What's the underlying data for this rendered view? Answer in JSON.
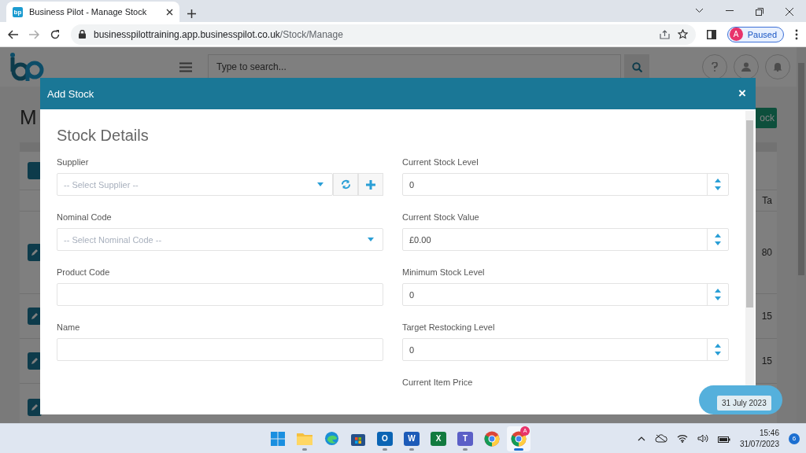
{
  "browser": {
    "tab": {
      "favicon": "bp",
      "title": "Business Pilot - Manage Stock",
      "selected": true
    },
    "url_host": "businesspilottraining.app.businesspilot.co.uk",
    "url_path": "/Stock/Manage",
    "profile": {
      "initial": "A",
      "status": "Paused"
    }
  },
  "app": {
    "search": {
      "placeholder": "Type to search..."
    },
    "page_title": "M",
    "action_button": "ock",
    "table": {
      "header": "Ta",
      "rows": [
        {
          "cell": "80"
        },
        {
          "cell": "15"
        },
        {
          "cell": "15"
        },
        {}
      ]
    }
  },
  "modal": {
    "title": "Add Stock",
    "close": "×",
    "section": "Stock Details",
    "left_fields": [
      {
        "label": "Supplier",
        "kind": "select",
        "placeholder": "-- Select Supplier --",
        "addons": true
      },
      {
        "label": "Nominal Code",
        "kind": "select",
        "placeholder": "-- Select Nominal Code --",
        "addons": false
      },
      {
        "label": "Product Code",
        "kind": "text"
      },
      {
        "label": "Name",
        "kind": "text"
      }
    ],
    "right_fields": [
      {
        "label": "Current Stock Level",
        "kind": "number",
        "value": "0"
      },
      {
        "label": "Current Stock Value",
        "kind": "number",
        "value": "£0.00"
      },
      {
        "label": "Minimum Stock Level",
        "kind": "number",
        "value": "0"
      },
      {
        "label": "Target Restocking Level",
        "kind": "number",
        "value": "0"
      },
      {
        "label": "Current Item Price",
        "kind": "cut"
      }
    ]
  },
  "date_tooltip": "31 July 2023",
  "taskbar": {
    "apps": [
      {
        "kind": "start",
        "running": false,
        "active": false
      },
      {
        "kind": "folder",
        "running": true,
        "active": false
      },
      {
        "kind": "edge",
        "running": false,
        "active": false
      },
      {
        "kind": "store",
        "running": false,
        "active": false
      },
      {
        "kind": "letter",
        "letter": "O",
        "color": "#0a64b4",
        "running": true,
        "active": false
      },
      {
        "kind": "letter",
        "letter": "W",
        "color": "#1d5bb8",
        "running": true,
        "active": false
      },
      {
        "kind": "letter",
        "letter": "X",
        "color": "#127a3f",
        "running": false,
        "active": false
      },
      {
        "kind": "letter",
        "letter": "T",
        "color": "#5b5fc7",
        "running": true,
        "active": false
      },
      {
        "kind": "chrome",
        "running": false,
        "active": false
      },
      {
        "kind": "chrome",
        "badge": "A",
        "running": true,
        "active": true
      }
    ],
    "time": "15:46",
    "date": "31/07/2023",
    "notifications": "6"
  }
}
